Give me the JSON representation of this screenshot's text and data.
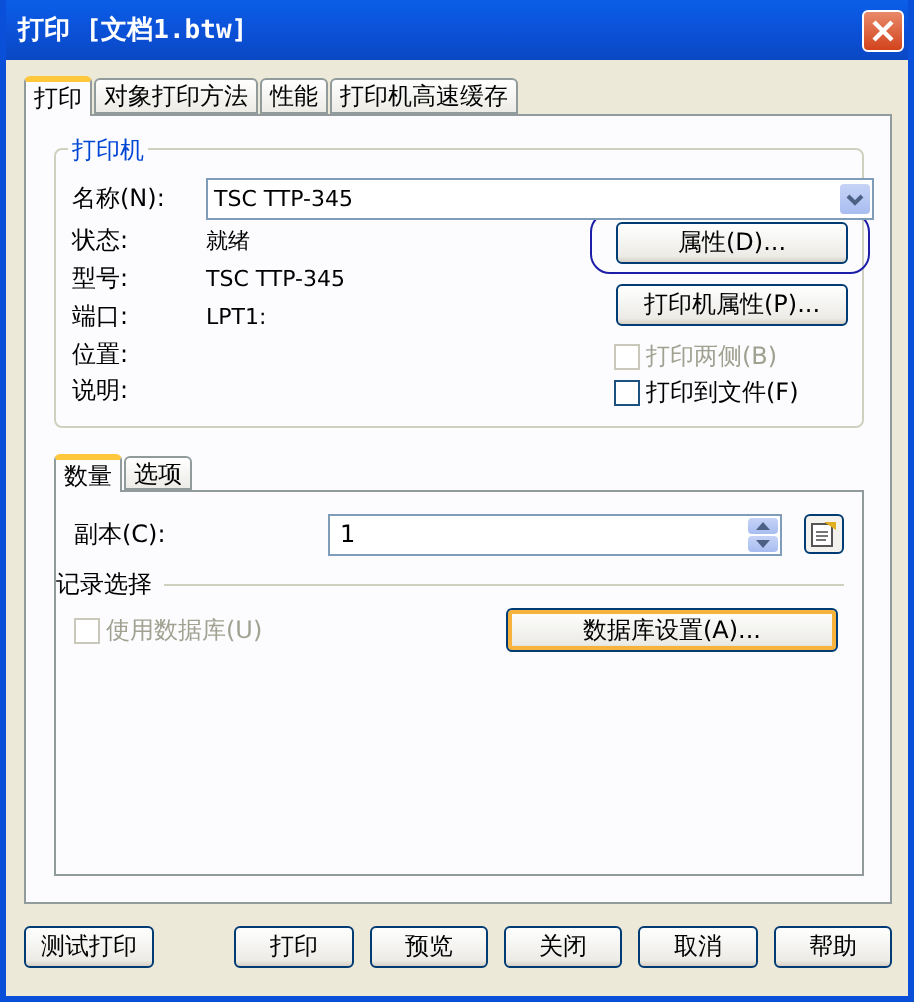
{
  "window": {
    "title": "打印 [文档1.btw]"
  },
  "tabs": [
    {
      "label": "打印",
      "selected": true
    },
    {
      "label": "对象打印方法",
      "selected": false
    },
    {
      "label": "性能",
      "selected": false
    },
    {
      "label": "打印机高速缓存",
      "selected": false
    }
  ],
  "printer_group": {
    "title": "打印机",
    "name_label": "名称(N):",
    "name_value": "TSC TTP-345",
    "fields": [
      {
        "label": "状态:",
        "value": "就绪"
      },
      {
        "label": "型号:",
        "value": "TSC TTP-345"
      },
      {
        "label": "端口:",
        "value": "LPT1:"
      },
      {
        "label": "位置:"
      },
      {
        "label": "说明:"
      }
    ],
    "buttons": [
      {
        "label": "属性(D)...",
        "focused": true
      },
      {
        "label": "打印机属性(P)...",
        "focused": false
      }
    ],
    "checkboxes": [
      {
        "label": "打印两侧(B)",
        "checked": false,
        "disabled": true
      },
      {
        "label": "打印到文件(F)",
        "checked": false,
        "disabled": false
      }
    ]
  },
  "sub_tabs": [
    {
      "label": "数量",
      "selected": true
    },
    {
      "label": "选项",
      "selected": false
    }
  ],
  "copies": {
    "label": "副本(C):",
    "value": "1"
  },
  "record_selection": {
    "title": "记录选择",
    "checkbox": {
      "label": "使用数据库(U)",
      "checked": false,
      "disabled": true
    },
    "button": {
      "label": "数据库设置(A)...",
      "default": true
    }
  },
  "footer_buttons": [
    "测试打印",
    "打印",
    "预览",
    "关闭",
    "取消",
    "帮助"
  ]
}
